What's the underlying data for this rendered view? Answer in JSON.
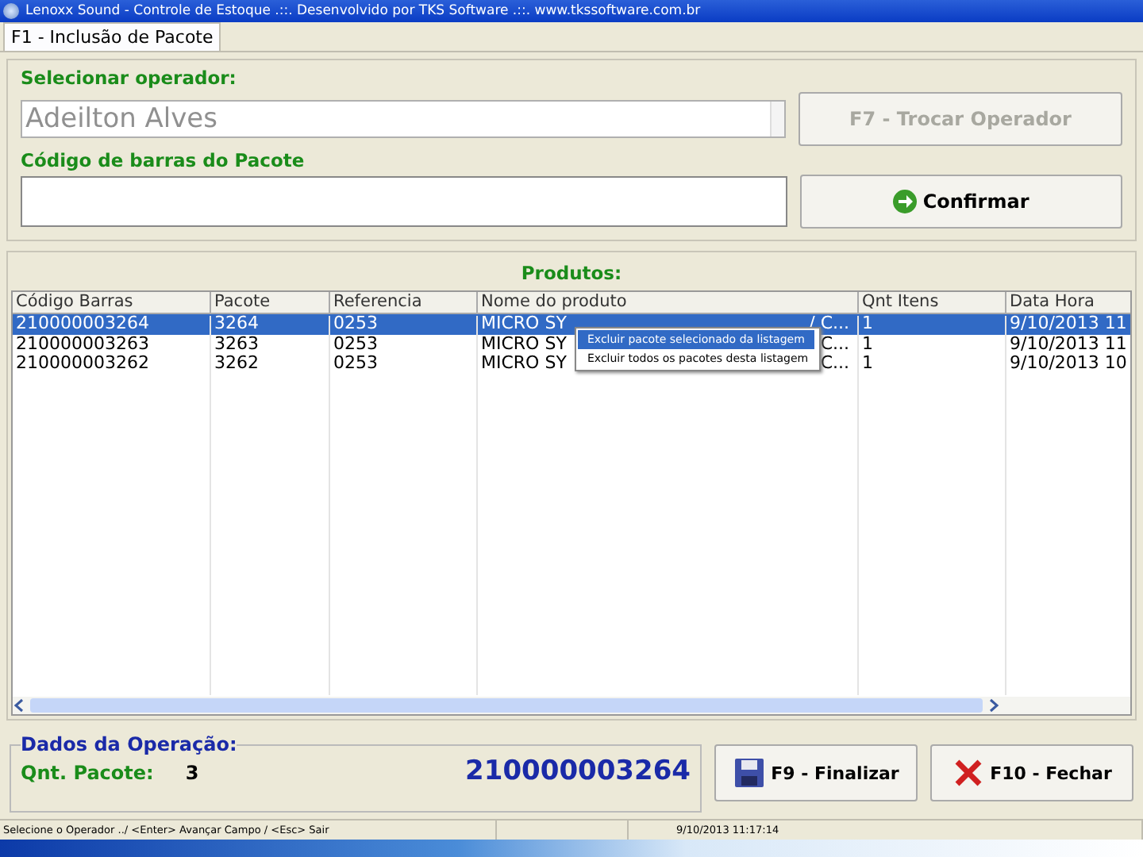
{
  "window": {
    "title": "Lenoxx Sound - Controle de Estoque .::. Desenvolvido por TKS Software .::. www.tkssoftware.com.br"
  },
  "tabs": [
    {
      "label": "F1 - Inclusão de Pacote",
      "selected": true
    }
  ],
  "operator": {
    "label": "Selecionar operador:",
    "value": "Adeilton Alves",
    "button": {
      "label": "F7 - Trocar Operador",
      "disabled": true
    }
  },
  "barcode": {
    "label": "Código de barras do Pacote",
    "button": {
      "label": "Confirmar",
      "disabled": false
    }
  },
  "products": {
    "title": "Produtos:",
    "columns": [
      "Código Barras",
      "Pacote",
      "Referencia",
      "Nome do produto",
      "Qnt Itens",
      "Data Hora"
    ],
    "rows": [
      {
        "selected": true,
        "cells": [
          "210000003264",
          "3264",
          "0253",
          "MICRO SY",
          "1",
          "9/10/2013 11"
        ],
        "name_tail": "/ C..."
      },
      {
        "selected": false,
        "cells": [
          "210000003263",
          "3263",
          "0253",
          "MICRO SY",
          "1",
          "9/10/2013 11"
        ],
        "name_tail": "C..."
      },
      {
        "selected": false,
        "cells": [
          "210000003262",
          "3262",
          "0253",
          "MICRO SY",
          "1",
          "9/10/2013 10"
        ],
        "name_tail": "C..."
      }
    ],
    "context_menu": [
      {
        "label": "Excluir pacote selecionado da listagem",
        "selected": true
      },
      {
        "label": "Excluir todos os pacotes desta listagem",
        "selected": false
      }
    ]
  },
  "operation": {
    "title": "Dados da Operação:",
    "count_label": "Qnt. Pacote:",
    "count": "3",
    "last_code": "210000003264"
  },
  "buttons": [
    {
      "kind": "save",
      "label": "F9 - Finalizar"
    },
    {
      "kind": "close",
      "label": "F10 - Fechar"
    }
  ],
  "status_bar": [
    "Selecione o Operador ../ <Enter> Avançar Campo / <Esc> Sair",
    "9/10/2013 11:17:14"
  ]
}
